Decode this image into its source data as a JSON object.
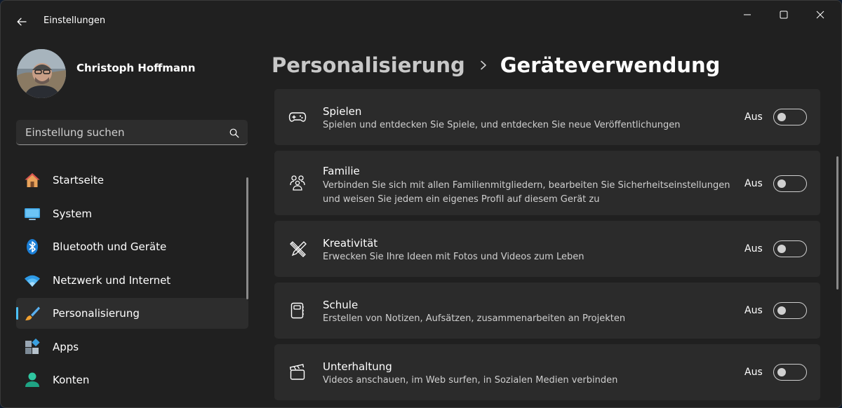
{
  "window": {
    "title": "Einstellungen"
  },
  "user": {
    "name": "Christoph Hoffmann"
  },
  "search": {
    "placeholder": "Einstellung suchen"
  },
  "nav": {
    "items": [
      {
        "label": "Startseite",
        "icon": "home-icon"
      },
      {
        "label": "System",
        "icon": "monitor-icon"
      },
      {
        "label": "Bluetooth und Geräte",
        "icon": "bluetooth-icon"
      },
      {
        "label": "Netzwerk und Internet",
        "icon": "wifi-icon"
      },
      {
        "label": "Personalisierung",
        "icon": "brush-icon",
        "active": true
      },
      {
        "label": "Apps",
        "icon": "apps-icon"
      },
      {
        "label": "Konten",
        "icon": "account-icon"
      }
    ]
  },
  "header": {
    "parent": "Personalisierung",
    "current": "Geräteverwendung"
  },
  "cards": [
    {
      "title": "Spielen",
      "desc": "Spielen und entdecken Sie Spiele, und entdecken Sie neue Veröffentlichungen",
      "state": "Aus",
      "icon": "gamepad-icon"
    },
    {
      "title": "Familie",
      "desc": "Verbinden Sie sich mit allen Familienmitgliedern, bearbeiten Sie Sicherheitseinstellungen und weisen Sie jedem ein eigenes Profil auf diesem Gerät zu",
      "state": "Aus",
      "icon": "family-icon"
    },
    {
      "title": "Kreativität",
      "desc": "Erwecken Sie Ihre Ideen mit Fotos und Videos zum Leben",
      "state": "Aus",
      "icon": "pen-ruler-icon"
    },
    {
      "title": "Schule",
      "desc": "Erstellen von Notizen, Aufsätzen, zusammenarbeiten an Projekten",
      "state": "Aus",
      "icon": "notebook-icon"
    },
    {
      "title": "Unterhaltung",
      "desc": "Videos anschauen, im Web surfen, in Sozialen Medien verbinden",
      "state": "Aus",
      "icon": "clapperboard-icon"
    }
  ],
  "colors": {
    "accent": "#4cc2ff",
    "background": "#202020",
    "card": "#2b2b2b"
  }
}
